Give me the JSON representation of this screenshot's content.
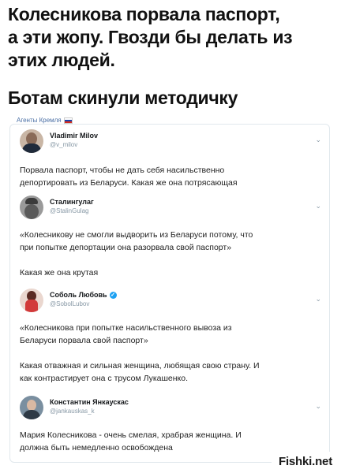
{
  "headline": {
    "lines": [
      "Колесникова порвала паспорт,",
      "а эти жопу. Гвозди бы делать из",
      "этих людей."
    ],
    "sub": "Ботам скинули методичку"
  },
  "tag": {
    "label": "Агенты Кремля"
  },
  "tweets": [
    {
      "name": "Vladimir Milov",
      "handle": "@v_milov",
      "verified": false,
      "text": [
        "Порвала паспорт, чтобы не дать себя насильственно",
        "депортировать из Беларуси. Какая же она потрясающая"
      ]
    },
    {
      "name": "Сталингулаг",
      "handle": "@StalinGulag",
      "verified": false,
      "text": [
        "«Колесникову не смогли выдворить из Беларуси потому, что",
        "при попытке депортации она разорвала свой паспорт»",
        "",
        "Какая же она крутая"
      ]
    },
    {
      "name": "Соболь Любовь",
      "handle": "@SobolLubov",
      "verified": true,
      "text": [
        "«Колесникова при попытке насильственного вывоза из",
        "Беларуси порвала свой паспорт»",
        "",
        "Какая отважная и сильная женщина, любящая свою страну. И",
        "как контрастирует она с трусом Лукашенко."
      ]
    },
    {
      "name": "Константин Янкаускас",
      "handle": "@jankauskas_k",
      "verified": false,
      "text": [
        "Мария Колесникова - очень смелая, храбрая женщина. И",
        "должна быть немедленно освобождена"
      ]
    }
  ],
  "watermark": "Fishki.net",
  "icons": {
    "chevron": "chevron-down-icon",
    "verified": "verified-badge-icon",
    "flag": "russia-flag-icon"
  }
}
